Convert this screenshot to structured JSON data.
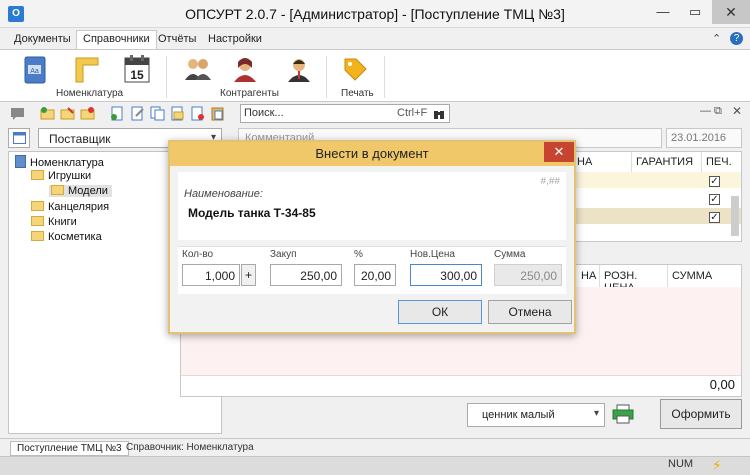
{
  "window": {
    "title": "ОПСУРТ 2.0.7 - [Администратор] - [Поступление ТМЦ №3]",
    "min": "—",
    "max": "▭",
    "close": "✕"
  },
  "menu": {
    "tabs": [
      "Документы",
      "Справочники",
      "Отчёты",
      "Настройки"
    ],
    "active": "Справочники",
    "right_icons": [
      "⌃",
      "?"
    ]
  },
  "ribbon": {
    "groups": [
      {
        "label": "Номенклатура"
      },
      {
        "label": "Контрагенты"
      },
      {
        "label": "Печать"
      }
    ],
    "calendar_day": "15"
  },
  "search": {
    "placeholder": "Поиск...",
    "shortcut": "Ctrl+F"
  },
  "left_pane": {
    "filter": "Поставщик",
    "tree": [
      {
        "label": "Номенклатура"
      },
      {
        "label": "Игрушки"
      },
      {
        "label": "Модели"
      },
      {
        "label": "Канцелярия"
      },
      {
        "label": "Книги"
      },
      {
        "label": "Косметика"
      }
    ]
  },
  "doc": {
    "comment_placeholder": "Комментарий",
    "date": "23.01.2016",
    "grid1_headers": [
      "НА",
      "ГАРАНТИЯ",
      "ПЕЧ."
    ],
    "check": "✓",
    "grid2_headers": [
      "НА",
      "РОЗН. ЦЕНА",
      "СУММА"
    ],
    "total": "0,00",
    "price_tag": "ценник малый",
    "form_button": "Оформить"
  },
  "status": {
    "doc_tab": "Поступление ТМЦ №3",
    "ref_tab": "Справочник: Номенклатура",
    "num": "NUM"
  },
  "modal": {
    "title": "Внести в документ",
    "close": "✕",
    "format_hint": "#,##",
    "name_label": "Наименование:",
    "name_value": "Модель танка Т-34-85",
    "fields": {
      "qty_label": "Кол-во",
      "qty_value": "1,000",
      "plus": "+",
      "buy_label": "Закуп",
      "buy_value": "250,00",
      "pct_label": "%",
      "pct_value": "20,00",
      "newprice_label": "Нов.Цена",
      "newprice_value": "300,00",
      "sum_label": "Сумма",
      "sum_value": "250,00"
    },
    "ok": "ОК",
    "cancel": "Отмена"
  }
}
